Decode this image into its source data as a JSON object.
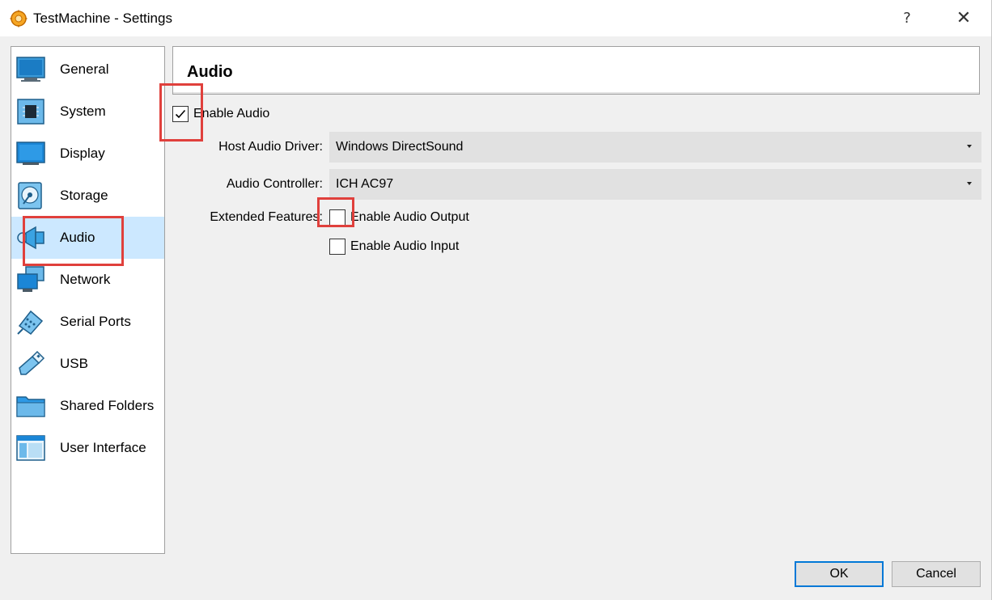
{
  "window": {
    "title": "TestMachine - Settings",
    "help_glyph": "?",
    "close_glyph": "✕",
    "app_icon": "virtualbox-gear-icon"
  },
  "sidebar": {
    "items": [
      {
        "label": "General",
        "icon": "general-monitor-icon",
        "selected": false
      },
      {
        "label": "System",
        "icon": "chip-icon",
        "selected": false
      },
      {
        "label": "Display",
        "icon": "display-icon",
        "selected": false
      },
      {
        "label": "Storage",
        "icon": "storage-disk-icon",
        "selected": false
      },
      {
        "label": "Audio",
        "icon": "speaker-icon",
        "selected": true
      },
      {
        "label": "Network",
        "icon": "network-icon",
        "selected": false
      },
      {
        "label": "Serial Ports",
        "icon": "serial-port-icon",
        "selected": false
      },
      {
        "label": "USB",
        "icon": "usb-icon",
        "selected": false
      },
      {
        "label": "Shared Folders",
        "icon": "folder-icon",
        "selected": false
      },
      {
        "label": "User Interface",
        "icon": "user-interface-icon",
        "selected": false
      }
    ]
  },
  "page": {
    "title": "Audio",
    "enable_audio": {
      "label": "Enable Audio",
      "checked": true
    },
    "host_driver": {
      "label": "Host Audio Driver:",
      "value": "Windows DirectSound"
    },
    "controller": {
      "label": "Audio Controller:",
      "value": "ICH AC97"
    },
    "extended": {
      "label": "Extended Features:",
      "output": {
        "label": "Enable Audio Output",
        "checked": false
      },
      "input": {
        "label": "Enable Audio Input",
        "checked": false
      }
    }
  },
  "buttons": {
    "ok": "OK",
    "cancel": "Cancel"
  },
  "colors": {
    "selection": "#cce8ff",
    "highlight": "#e0403c",
    "ok_border": "#0078d7"
  }
}
